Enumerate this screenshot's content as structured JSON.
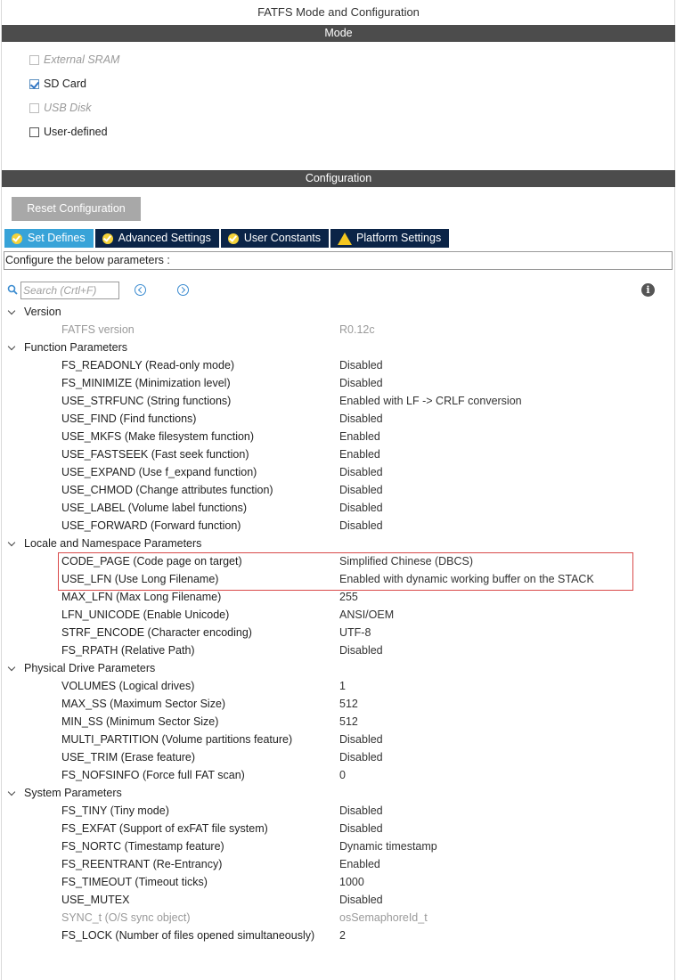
{
  "window": {
    "title": "FATFS Mode and Configuration"
  },
  "mode": {
    "header": "Mode",
    "items": [
      {
        "label": "External SRAM",
        "checked": false,
        "enabled": false
      },
      {
        "label": "SD Card",
        "checked": true,
        "enabled": true
      },
      {
        "label": "USB Disk",
        "checked": false,
        "enabled": false
      },
      {
        "label": "User-defined",
        "checked": false,
        "enabled": true
      }
    ]
  },
  "configuration": {
    "header": "Configuration",
    "reset_label": "Reset Configuration",
    "tabs": [
      {
        "label": "Set Defines",
        "icon": "ok-icon",
        "active": true
      },
      {
        "label": "Advanced Settings",
        "icon": "ok-icon",
        "active": false
      },
      {
        "label": "User Constants",
        "icon": "ok-icon",
        "active": false
      },
      {
        "label": "Platform Settings",
        "icon": "warning-icon",
        "active": false
      }
    ],
    "description": "Configure the below parameters :",
    "search_placeholder": "Search (Crtl+F)"
  },
  "groups": [
    {
      "name": "Version",
      "params": [
        {
          "name": "FATFS version",
          "value": "R0.12c",
          "muted": true
        }
      ]
    },
    {
      "name": "Function Parameters",
      "params": [
        {
          "name": "FS_READONLY (Read-only mode)",
          "value": "Disabled"
        },
        {
          "name": "FS_MINIMIZE (Minimization level)",
          "value": "Disabled"
        },
        {
          "name": "USE_STRFUNC (String functions)",
          "value": "Enabled with LF -> CRLF conversion"
        },
        {
          "name": "USE_FIND (Find functions)",
          "value": "Disabled"
        },
        {
          "name": "USE_MKFS (Make filesystem function)",
          "value": "Enabled"
        },
        {
          "name": "USE_FASTSEEK (Fast seek function)",
          "value": "Enabled"
        },
        {
          "name": "USE_EXPAND (Use f_expand function)",
          "value": "Disabled"
        },
        {
          "name": "USE_CHMOD (Change attributes function)",
          "value": "Disabled"
        },
        {
          "name": "USE_LABEL (Volume label functions)",
          "value": "Disabled"
        },
        {
          "name": "USE_FORWARD (Forward function)",
          "value": "Disabled"
        }
      ]
    },
    {
      "name": "Locale and Namespace Parameters",
      "params": [
        {
          "name": "CODE_PAGE (Code page on target)",
          "value": "Simplified Chinese (DBCS)"
        },
        {
          "name": "USE_LFN (Use Long Filename)",
          "value": "Enabled with dynamic working buffer on the STACK"
        },
        {
          "name": "MAX_LFN (Max Long Filename)",
          "value": "255"
        },
        {
          "name": "LFN_UNICODE (Enable Unicode)",
          "value": "ANSI/OEM"
        },
        {
          "name": "STRF_ENCODE (Character encoding)",
          "value": "UTF-8"
        },
        {
          "name": "FS_RPATH (Relative Path)",
          "value": "Disabled"
        }
      ]
    },
    {
      "name": "Physical Drive Parameters",
      "params": [
        {
          "name": "VOLUMES (Logical drives)",
          "value": "1"
        },
        {
          "name": "MAX_SS (Maximum Sector Size)",
          "value": "512"
        },
        {
          "name": "MIN_SS (Minimum Sector Size)",
          "value": "512"
        },
        {
          "name": "MULTI_PARTITION (Volume partitions feature)",
          "value": "Disabled"
        },
        {
          "name": "USE_TRIM (Erase feature)",
          "value": "Disabled"
        },
        {
          "name": "FS_NOFSINFO (Force full FAT scan)",
          "value": "0"
        }
      ]
    },
    {
      "name": "System Parameters",
      "params": [
        {
          "name": "FS_TINY (Tiny mode)",
          "value": "Disabled"
        },
        {
          "name": "FS_EXFAT (Support of exFAT file system)",
          "value": "Disabled"
        },
        {
          "name": "FS_NORTC (Timestamp feature)",
          "value": "Dynamic timestamp"
        },
        {
          "name": "FS_REENTRANT (Re-Entrancy)",
          "value": "Enabled"
        },
        {
          "name": "FS_TIMEOUT (Timeout ticks)",
          "value": "1000"
        },
        {
          "name": "USE_MUTEX",
          "value": "Disabled"
        },
        {
          "name": "SYNC_t (O/S sync object)",
          "value": "osSemaphoreId_t",
          "muted": true
        },
        {
          "name": "FS_LOCK (Number of files opened simultaneously)",
          "value": "2"
        }
      ]
    }
  ],
  "colors": {
    "header_bar": "#4c4c4c",
    "tab_active": "#38a3d8",
    "tab_inactive": "#0b2447",
    "highlight": "#d94a4a"
  }
}
